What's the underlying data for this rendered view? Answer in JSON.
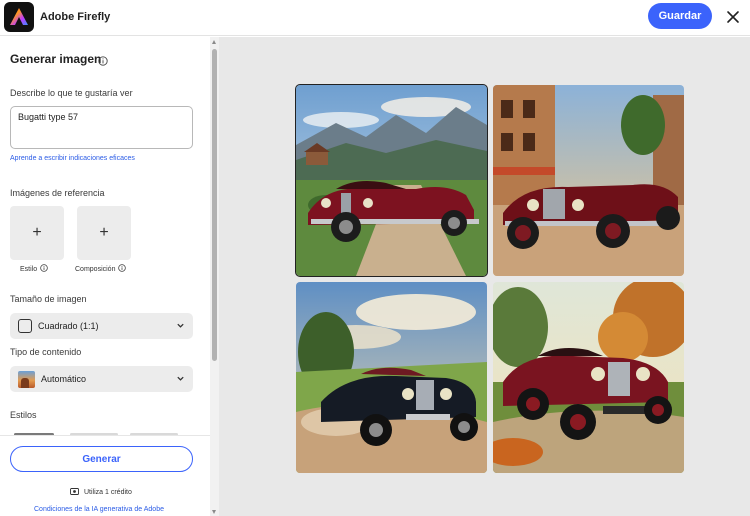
{
  "header": {
    "app_title": "Adobe Firefly",
    "save_label": "Guardar",
    "accent_color": "#3b63fb"
  },
  "panel": {
    "title": "Generar imagen",
    "prompt_label": "Describe lo que te gustaría ver",
    "prompt_value": "Bugatti type 57",
    "learn_link": "Aprende a escribir indicaciones eficaces",
    "reference_label": "Imágenes de referencia",
    "reference_tiles": [
      {
        "label": "Estilo",
        "icon": "plus-icon"
      },
      {
        "label": "Composición",
        "icon": "plus-icon"
      }
    ],
    "size_label": "Tamaño de imagen",
    "size_value": "Cuadrado (1:1)",
    "content_type_label": "Tipo de contenido",
    "content_type_value": "Automático",
    "styles_label": "Estilos",
    "generate_label": "Generar",
    "credits_text": "Utiliza 1 crédito",
    "terms_link": "Condiciones de la IA generativa de Adobe"
  },
  "results": [
    {
      "scene": "vintage red roadster on country road with mountains",
      "selected": true
    },
    {
      "scene": "vintage red roadster on old town street at sunset",
      "selected": false
    },
    {
      "scene": "vintage dark roadster on dusty road kicking dust",
      "selected": false
    },
    {
      "scene": "vintage red and black roadster in autumn park",
      "selected": false
    }
  ]
}
